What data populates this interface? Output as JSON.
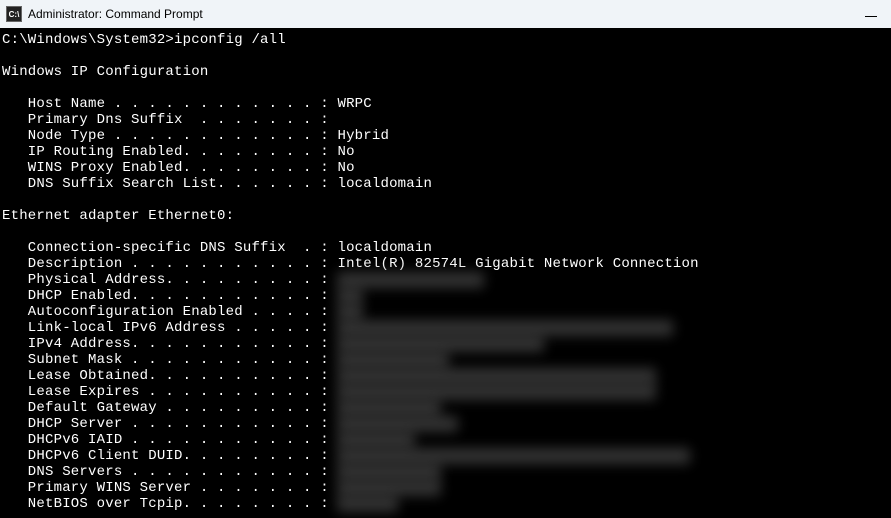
{
  "titlebar": {
    "icon_text": "C:\\",
    "title": "Administrator: Command Prompt"
  },
  "prompt": {
    "path": "C:\\Windows\\System32>",
    "command": "ipconfig /all"
  },
  "sections": {
    "ip_config_header": "Windows IP Configuration",
    "host_name": {
      "label": "   Host Name . . . . . . . . . . . . : ",
      "value": "WRPC"
    },
    "primary_dns_suffix": {
      "label": "   Primary Dns Suffix  . . . . . . . :",
      "value": ""
    },
    "node_type": {
      "label": "   Node Type . . . . . . . . . . . . : ",
      "value": "Hybrid"
    },
    "ip_routing": {
      "label": "   IP Routing Enabled. . . . . . . . : ",
      "value": "No"
    },
    "wins_proxy": {
      "label": "   WINS Proxy Enabled. . . . . . . . : ",
      "value": "No"
    },
    "dns_suffix_list": {
      "label": "   DNS Suffix Search List. . . . . . : ",
      "value": "localdomain"
    },
    "adapter_header": "Ethernet adapter Ethernet0:",
    "conn_dns_suffix": {
      "label": "   Connection-specific DNS Suffix  . : ",
      "value": "localdomain"
    },
    "description": {
      "label": "   Description . . . . . . . . . . . : ",
      "value": "Intel(R) 82574L Gigabit Network Connection"
    },
    "physical_address": {
      "label": "   Physical Address. . . . . . . . . : ",
      "redacted": "XX-XX-XX-XX-XX-XX"
    },
    "dhcp_enabled": {
      "label": "   DHCP Enabled. . . . . . . . . . . : ",
      "redacted": "Yes"
    },
    "autoconfig": {
      "label": "   Autoconfiguration Enabled . . . . : ",
      "redacted": "Yes"
    },
    "link_local_ipv6": {
      "label": "   Link-local IPv6 Address . . . . . : ",
      "redacted": "fe80::XXXX:XXXX:XXXX:XXXX%XX(Preferred)"
    },
    "ipv4_address": {
      "label": "   IPv4 Address. . . . . . . . . . . : ",
      "redacted": "XXX.XXX.X.XXX(Preferred)"
    },
    "subnet_mask": {
      "label": "   Subnet Mask . . . . . . . . . . . : ",
      "redacted": "XXX.XXX.XXX.X"
    },
    "lease_obtained": {
      "label": "   Lease Obtained. . . . . . . . . . : ",
      "redacted": "Xxxxxxxx, Xxxxxxxx X, XXXX X:XX:XX XX"
    },
    "lease_expires": {
      "label": "   Lease Expires . . . . . . . . . . : ",
      "redacted": "Xxxxxxxx, Xxxxxxxx X, XXXX X:XX:XX XX"
    },
    "default_gateway": {
      "label": "   Default Gateway . . . . . . . . . : ",
      "redacted": "XXX.XXX.XX.X"
    },
    "dhcp_server": {
      "label": "   DHCP Server . . . . . . . . . . . : ",
      "redacted": "XXX.XXX.XX.XXX"
    },
    "dhcpv6_iaid": {
      "label": "   DHCPv6 IAID . . . . . . . . . . . : ",
      "redacted": "XXXXXXXXX"
    },
    "dhcpv6_duid": {
      "label": "   DHCPv6 Client DUID. . . . . . . . : ",
      "redacted": "XX-XX-XX-XX-XX-XX-XX-XX-XX-XX-XX-XX-XX-XX"
    },
    "dns_servers": {
      "label": "   DNS Servers . . . . . . . . . . . : ",
      "redacted": "XXX.XXX.XX.X"
    },
    "primary_wins": {
      "label": "   Primary WINS Server . . . . . . . : ",
      "redacted": "XXX.XXX.XX.X"
    },
    "netbios": {
      "label": "   NetBIOS over Tcpip. . . . . . . . : ",
      "redacted": "Enabled"
    }
  }
}
